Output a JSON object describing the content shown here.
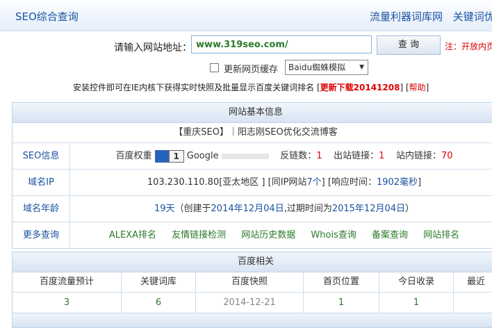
{
  "header": {
    "title": "SEO综合查询",
    "links": [
      "流量利器词库网",
      "关键词优化"
    ]
  },
  "query": {
    "label": "请输入网站地址：",
    "value": "www.319seo.com/",
    "button": "查 询",
    "note": "注：开放内页"
  },
  "options": {
    "refresh_label": "更新网页缓存",
    "spider_select": "Baidu蜘蛛模拟"
  },
  "install": {
    "text": "安装控件即可在IE内核下获得实时快照及批量显示百度关键词排名",
    "update_link": "更新下载20141208",
    "help_link": "帮助"
  },
  "basic": {
    "heading": "网站基本信息",
    "site_name": "【重庆SEO】｜阳志刚SEO优化交流博客",
    "rows": {
      "seo_info": {
        "label": "SEO信息",
        "baidu_weight_label": "百度权重",
        "baidu_weight": "1",
        "google_label": "Google",
        "backlinks_label": "反链数：",
        "backlinks": "1",
        "outbound_label": "出站链接：",
        "outbound": "1",
        "internal_label": "站内链接：",
        "internal": "70"
      },
      "domain_ip": {
        "label": "域名IP",
        "ip": "103.230.110.80[亚太地区 ]",
        "same_ip_prefix": "[同IP网站",
        "same_ip_count": "7个",
        "same_ip_suffix": "]",
        "response_prefix": "[响应时间：",
        "response_time": "1902毫秒",
        "response_suffix": "]"
      },
      "domain_age": {
        "label": "域名年龄",
        "age": "19天",
        "created_prefix": "（创建于",
        "created": "2014年12月04日",
        "expire_prefix": ",过期时间为",
        "expires": "2015年12月04日",
        "suffix": "）"
      },
      "more": {
        "label": "更多查询",
        "links": [
          "ALEXA排名",
          "友情链接检测",
          "网站历史数据",
          "Whois查询",
          "备案查询",
          "网站排名"
        ]
      }
    }
  },
  "baidu": {
    "heading": "百度相关",
    "columns": [
      "百度流量预计",
      "关键词库",
      "百度快照",
      "首页位置",
      "今日收录",
      "最近"
    ],
    "values": [
      "3",
      "6",
      "2014-12-21",
      "1",
      "1",
      ""
    ]
  }
}
